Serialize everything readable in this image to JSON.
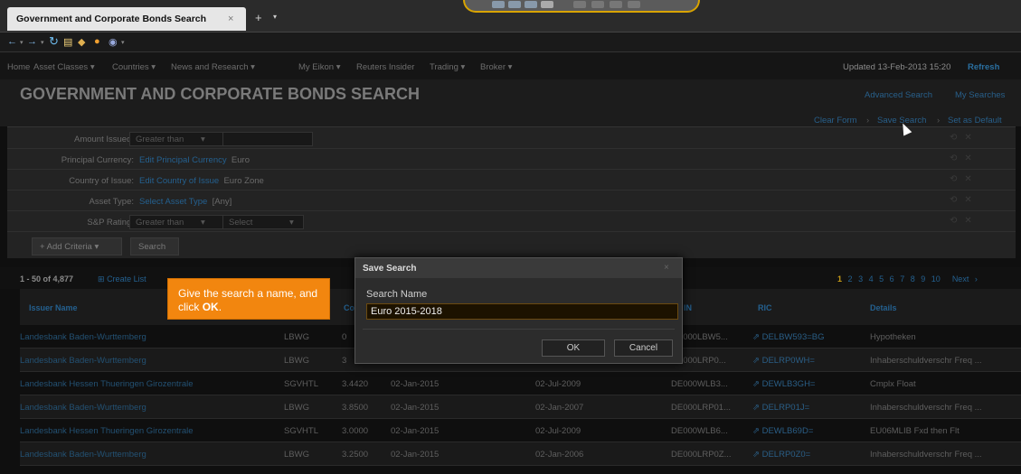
{
  "tab": {
    "title": "Government and Corporate Bonds Search",
    "close": "×",
    "plus": "+",
    "caret": "▾"
  },
  "toolbar": {
    "icons": [
      "back-arrow-icon",
      "forward-arrow-icon",
      "refresh-icon",
      "print-icon",
      "tools-icon",
      "apps-icon"
    ]
  },
  "menubar": {
    "items": [
      "Home",
      "Asset Classes ▾",
      "Countries ▾",
      "News and Research ▾",
      "My Eikon ▾",
      "Reuters Insider",
      "Trading ▾",
      "Broker ▾"
    ],
    "updated": "Updated 13-Feb-2013 15:20",
    "refresh": "Refresh"
  },
  "header": {
    "title": "GOVERNMENT AND CORPORATE BONDS SEARCH",
    "advanced_search": "Advanced Search",
    "my_searches": "My Searches",
    "clear_form": "Clear Form",
    "save_search": "Save Search",
    "set_default": "Set as Default",
    "sep": "›"
  },
  "criteria": {
    "amount_issued": {
      "label": "Amount Issued:",
      "operator": "Greater than"
    },
    "principal_currency": {
      "label": "Principal Currency:",
      "link": "Edit Principal Currency",
      "value": "Euro"
    },
    "country_of_issue": {
      "label": "Country of Issue:",
      "link": "Edit Country of Issue",
      "value": "Euro Zone"
    },
    "asset_type": {
      "label": "Asset Type:",
      "link": "Select Asset Type",
      "value": "[Any]"
    },
    "sp_rating": {
      "label": "S&P Rating:",
      "operator": "Greater than",
      "select": "Select"
    },
    "add_criteria": "+ Add Criteria ▾",
    "search": "Search"
  },
  "results": {
    "count": "1 - 50 of 4,877",
    "create_list": "Create List",
    "pages": [
      "1",
      "2",
      "3",
      "4",
      "5",
      "6",
      "7",
      "8",
      "9",
      "10"
    ],
    "current_page": "1",
    "next": "Next ›"
  },
  "table": {
    "headers": {
      "issuer": "Issuer Name",
      "co": "Co",
      "in": "IN",
      "ric": "RIC",
      "details": "Details"
    },
    "rows": [
      {
        "issuer": "Landesbank Baden-Wurttemberg",
        "ticker": "LBWG",
        "coupon": "0",
        "maturity": "",
        "issue": "",
        "isin": "DE000LBW5...",
        "ric": "DELBW593=BG",
        "details": "Hypotheken"
      },
      {
        "issuer": "Landesbank Baden-Wurttemberg",
        "ticker": "LBWG",
        "coupon": "3",
        "maturity": "",
        "issue": "",
        "isin": "DE000LRP0...",
        "ric": "DELRP0WH=",
        "details": "Inhaberschuldverschr Freq ..."
      },
      {
        "issuer": "Landesbank Hessen Thueringen Girozentrale",
        "ticker": "SGVHTL",
        "coupon": "3.4420",
        "maturity": "02-Jan-2015",
        "issue": "02-Jul-2009",
        "isin": "DE000WLB3...",
        "ric": "DEWLB3GH=",
        "details": "Cmplx Float"
      },
      {
        "issuer": "Landesbank Baden-Wurttemberg",
        "ticker": "LBWG",
        "coupon": "3.8500",
        "maturity": "02-Jan-2015",
        "issue": "02-Jan-2007",
        "isin": "DE000LRP01...",
        "ric": "DELRP01J=",
        "details": "Inhaberschuldverschr Freq ..."
      },
      {
        "issuer": "Landesbank Hessen Thueringen Girozentrale",
        "ticker": "SGVHTL",
        "coupon": "3.0000",
        "maturity": "02-Jan-2015",
        "issue": "02-Jul-2009",
        "isin": "DE000WLB6...",
        "ric": "DEWLB69D=",
        "details": "EU06MLIB Fxd then Flt"
      },
      {
        "issuer": "Landesbank Baden-Wurttemberg",
        "ticker": "LBWG",
        "coupon": "3.2500",
        "maturity": "02-Jan-2015",
        "issue": "02-Jan-2006",
        "isin": "DE000LRP0Z...",
        "ric": "DELRP0Z0=",
        "details": "Inhaberschuldverschr Freq ..."
      }
    ]
  },
  "tooltip": {
    "text": "Give the search a name, and click",
    "bold": "OK",
    "end": "."
  },
  "dialog": {
    "title": "Save Search",
    "close": "×",
    "label": "Search Name",
    "value": "Euro 2015-2018",
    "ok": "OK",
    "cancel": "Cancel"
  }
}
